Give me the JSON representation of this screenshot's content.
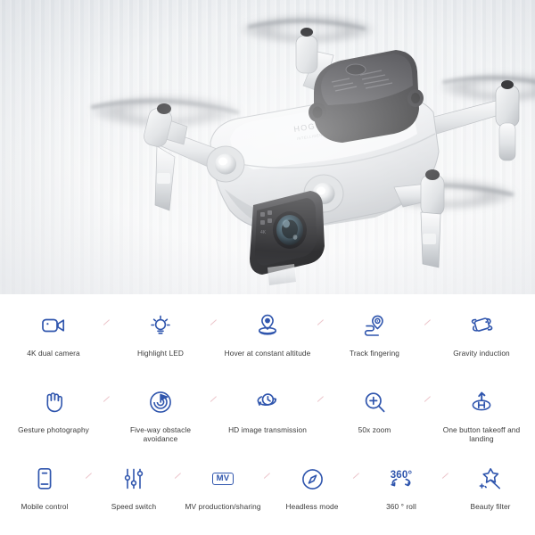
{
  "hero": {
    "product_name": "HOGOL J1",
    "alt": "White quadcopter mini drone with gimbal camera hovering, blurred spinning propellers, light grey studio background",
    "background_color": "#eef0f2",
    "body_color": "#e4e6e9",
    "accent_dark_color": "#2b2b2e"
  },
  "features": {
    "icon_color": "#2f55ad",
    "label_color": "#3a3a3a",
    "separator_color": "#d98a96",
    "rows": [
      [
        {
          "icon": "video-camera-icon",
          "label": "4K dual camera"
        },
        {
          "icon": "lightbulb-icon",
          "label": "Highlight LED"
        },
        {
          "icon": "hover-altitude-icon",
          "label": "Hover at constant altitude"
        },
        {
          "icon": "track-path-pin-icon",
          "label": "Track fingering"
        },
        {
          "icon": "gravity-tilt-phone-icon",
          "label": "Gravity induction"
        }
      ],
      [
        {
          "icon": "waving-hand-icon",
          "label": "Gesture photography"
        },
        {
          "icon": "radar-flag-icon",
          "label": "Five-way obstacle avoidance"
        },
        {
          "icon": "image-transmission-icon",
          "label": "HD image transmission"
        },
        {
          "icon": "magnifier-plus-icon",
          "label": "50x zoom"
        },
        {
          "icon": "takeoff-landing-pad-icon",
          "label": "One button takeoff and landing"
        }
      ],
      [
        {
          "icon": "mobile-phone-icon",
          "label": "Mobile control"
        },
        {
          "icon": "sliders-icon",
          "label": "Speed switch"
        },
        {
          "icon": "mv-badge-icon",
          "label": "MV production/sharing",
          "text": "MV"
        },
        {
          "icon": "compass-icon",
          "label": "Headless mode"
        },
        {
          "icon": "rotate-360-icon",
          "label": "360 ° roll",
          "text": "360°"
        },
        {
          "icon": "magic-wand-star-icon",
          "label": "Beauty filter"
        }
      ]
    ]
  }
}
